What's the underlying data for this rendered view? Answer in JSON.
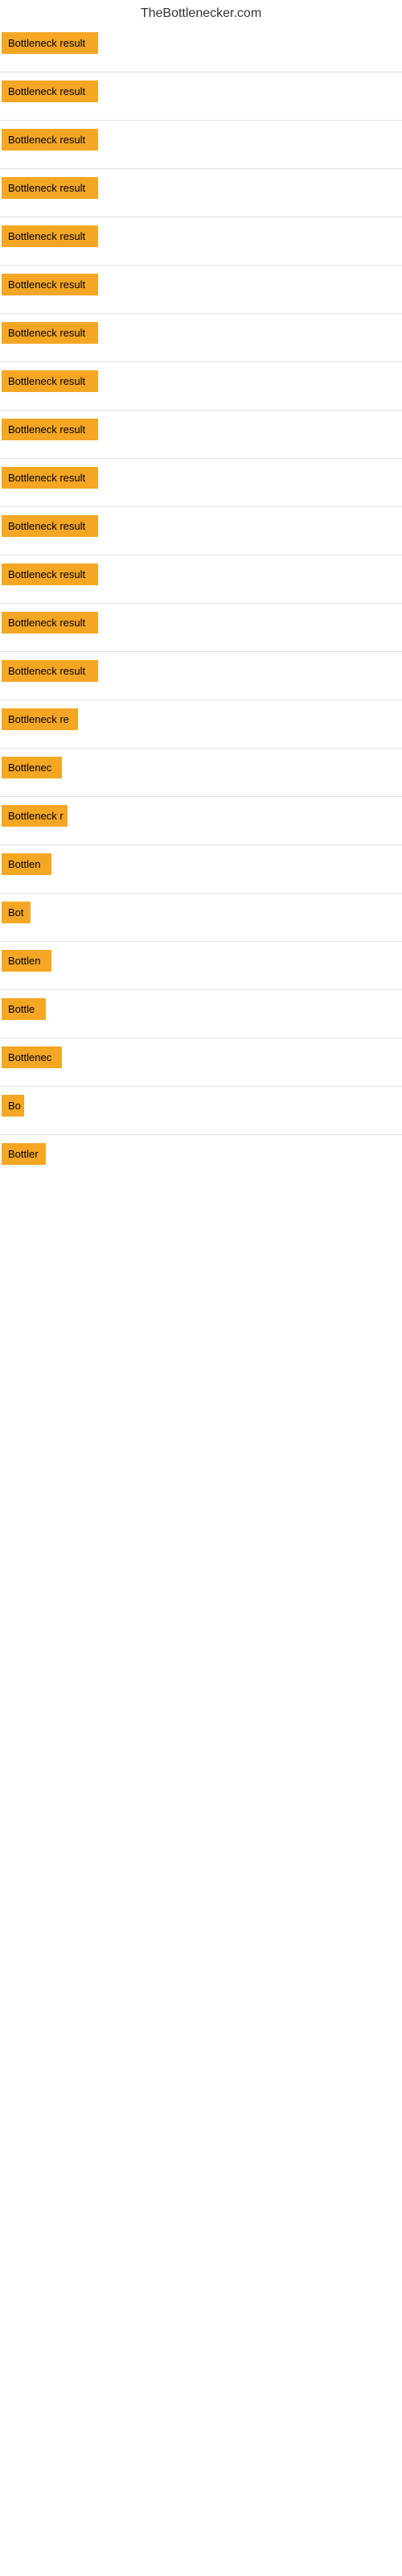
{
  "site": {
    "title": "TheBottlenecker.com"
  },
  "rows": [
    {
      "id": 1,
      "label": "Bottleneck result",
      "width": 120
    },
    {
      "id": 2,
      "label": "Bottleneck result",
      "width": 120
    },
    {
      "id": 3,
      "label": "Bottleneck result",
      "width": 120
    },
    {
      "id": 4,
      "label": "Bottleneck result",
      "width": 120
    },
    {
      "id": 5,
      "label": "Bottleneck result",
      "width": 120
    },
    {
      "id": 6,
      "label": "Bottleneck result",
      "width": 120
    },
    {
      "id": 7,
      "label": "Bottleneck result",
      "width": 120
    },
    {
      "id": 8,
      "label": "Bottleneck result",
      "width": 120
    },
    {
      "id": 9,
      "label": "Bottleneck result",
      "width": 120
    },
    {
      "id": 10,
      "label": "Bottleneck result",
      "width": 120
    },
    {
      "id": 11,
      "label": "Bottleneck result",
      "width": 120
    },
    {
      "id": 12,
      "label": "Bottleneck result",
      "width": 120
    },
    {
      "id": 13,
      "label": "Bottleneck result",
      "width": 120
    },
    {
      "id": 14,
      "label": "Bottleneck result",
      "width": 120
    },
    {
      "id": 15,
      "label": "Bottleneck re",
      "width": 95
    },
    {
      "id": 16,
      "label": "Bottlenec",
      "width": 75
    },
    {
      "id": 17,
      "label": "Bottleneck r",
      "width": 82
    },
    {
      "id": 18,
      "label": "Bottlen",
      "width": 62
    },
    {
      "id": 19,
      "label": "Bot",
      "width": 36
    },
    {
      "id": 20,
      "label": "Bottlen",
      "width": 62
    },
    {
      "id": 21,
      "label": "Bottle",
      "width": 55
    },
    {
      "id": 22,
      "label": "Bottlenec",
      "width": 75
    },
    {
      "id": 23,
      "label": "Bo",
      "width": 28
    },
    {
      "id": 24,
      "label": "Bottler",
      "width": 55
    }
  ]
}
